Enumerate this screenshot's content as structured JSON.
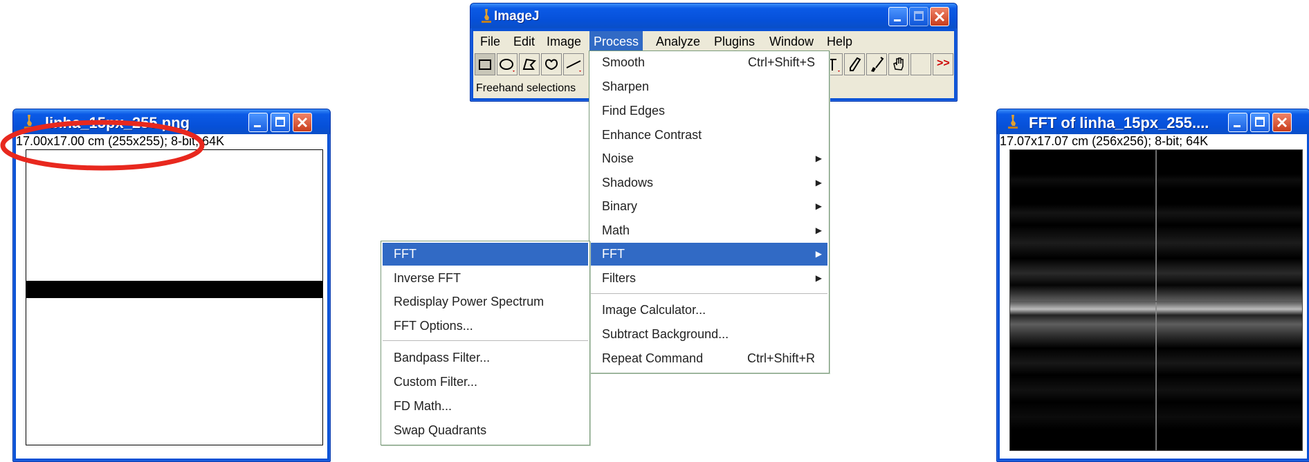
{
  "left_window": {
    "title": "linha_15px_255.png",
    "info": "17.00x17.00 cm (255x255); 8-bit; 64K"
  },
  "right_window": {
    "title": "FFT of linha_15px_255....",
    "info": "17.07x17.07 cm (256x256); 8-bit; 64K"
  },
  "imagej": {
    "title": "ImageJ",
    "menubar": [
      "File",
      "Edit",
      "Image",
      "Process",
      "Analyze",
      "Plugins",
      "Window",
      "Help"
    ],
    "active_menu": "Process",
    "status": "Freehand selections",
    "more_tools": ">>"
  },
  "process_menu": [
    {
      "label": "Smooth",
      "shortcut": "Ctrl+Shift+S"
    },
    {
      "label": "Sharpen"
    },
    {
      "label": "Find Edges"
    },
    {
      "label": "Enhance Contrast"
    },
    {
      "label": "Noise",
      "submenu": true
    },
    {
      "label": "Shadows",
      "submenu": true
    },
    {
      "label": "Binary",
      "submenu": true
    },
    {
      "label": "Math",
      "submenu": true
    },
    {
      "label": "FFT",
      "submenu": true,
      "highlighted": true
    },
    {
      "label": "Filters",
      "submenu": true
    },
    {
      "label": "Image Calculator..."
    },
    {
      "label": "Subtract Background..."
    },
    {
      "label": "Repeat Command",
      "shortcut": "Ctrl+Shift+R"
    }
  ],
  "fft_submenu": [
    {
      "label": "FFT",
      "highlighted": true
    },
    {
      "label": "Inverse FFT"
    },
    {
      "label": "Redisplay Power Spectrum"
    },
    {
      "label": "FFT Options..."
    },
    {
      "label": "Bandpass Filter..."
    },
    {
      "label": "Custom Filter..."
    },
    {
      "label": "FD Math..."
    },
    {
      "label": "Swap Quadrants"
    }
  ],
  "colors": {
    "menu_highlight": "#316ac5",
    "annotation": "#e8281e",
    "window_frame": "#0a52d6"
  }
}
